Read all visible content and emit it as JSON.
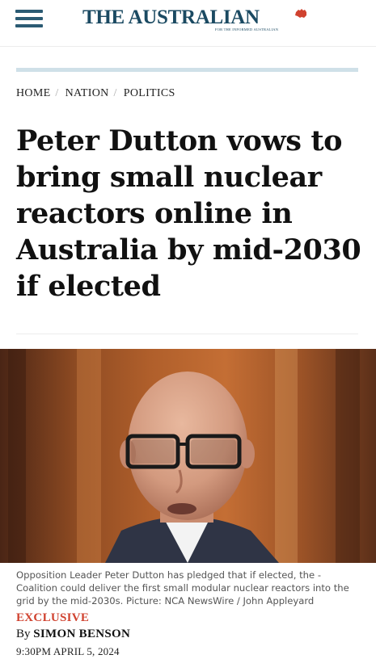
{
  "header": {
    "logo_text": "THE AUSTRALIAN",
    "logo_tagline": "FOR THE INFORMED AUSTRALIAN",
    "menu_icon": "hamburger-menu-icon",
    "brand_color": "#1b4a62",
    "accent_color": "#d0422f"
  },
  "breadcrumb": {
    "items": [
      {
        "label": "HOME"
      },
      {
        "label": "NATION"
      },
      {
        "label": "POLITICS"
      }
    ],
    "separator": "/"
  },
  "article": {
    "headline": "Peter Dutton vows to bring small nuclear reactors online in Australia by mid-2030 if elected",
    "caption": "Opposition Leader Peter Dutton has pledged that if elected, the - Coalition could deliver the first small modular nuclear reactors into the grid by the mid-2030s. Picture: NCA NewsWire / John Appleyard",
    "label": "EXCLUSIVE",
    "by_prefix": "By",
    "author": "SIMON BENSON",
    "timestamp": "9:30PM APRIL 5, 2024"
  }
}
